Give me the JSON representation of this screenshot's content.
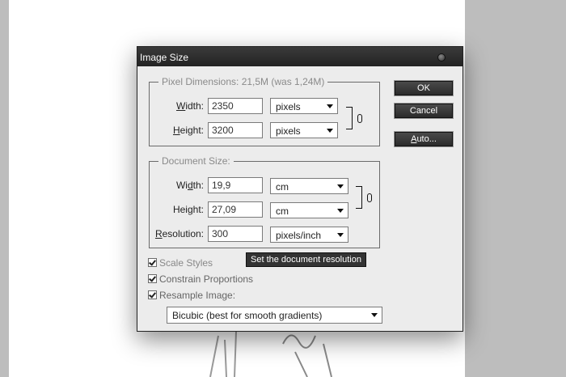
{
  "dialog": {
    "title": "Image Size"
  },
  "buttons": {
    "ok": "OK",
    "cancel": "Cancel",
    "auto": "Auto..."
  },
  "pixel_dimensions": {
    "legend": "Pixel Dimensions:  21,5M (was 1,24M)",
    "width": {
      "label": "Width:",
      "value": "2350",
      "unit": "pixels"
    },
    "height": {
      "label": "Height:",
      "value": "3200",
      "unit": "pixels"
    }
  },
  "document_size": {
    "legend": "Document Size:",
    "width": {
      "label": "Width:",
      "value": "19,9",
      "unit": "cm"
    },
    "height": {
      "label": "Height:",
      "value": "27,09",
      "unit": "cm"
    },
    "resolution": {
      "label": "Resolution:",
      "value": "300",
      "unit": "pixels/inch"
    }
  },
  "options": {
    "scale_styles": "Scale Styles",
    "constrain_proportions": "Constrain Proportions",
    "resample_image": "Resample Image:",
    "resample_method": "Bicubic (best for smooth gradients)"
  },
  "tooltip": "Set the document resolution"
}
